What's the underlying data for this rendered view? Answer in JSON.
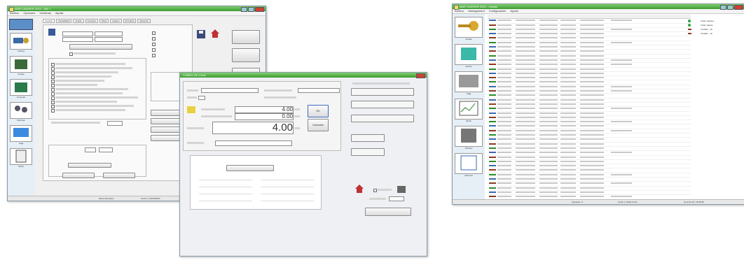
{
  "window1": {
    "title": "MAR CASHIER 2010 - Win 7",
    "menu": [
      "Archivo",
      "Opciones",
      "Ventanas",
      "Ayuda"
    ],
    "toolbar": [
      "Cobros",
      "Ventas",
      "Compras",
      "Informes",
      "Caja",
      "Stock"
    ],
    "tabs": [
      "General",
      "Contabilidad",
      "Ventas",
      "Compras",
      "Stock",
      "Cajeros",
      "Formatos",
      "Opciones"
    ],
    "status": [
      "Modo Operativo",
      "CAJA 1 | 22/10/2010"
    ]
  },
  "window2": {
    "title": "COBRO DE CAJA",
    "amount_1": "4.00",
    "amount_2": "0.00",
    "total": "4.00",
    "ok": "OK",
    "cancel": "Cancelar"
  },
  "window3": {
    "title": "MAR CASHIER 2010 - Listado",
    "menu": [
      "Archivo",
      "Management",
      "Configuración",
      "Ayuda"
    ],
    "toolbar": [
      "Ventas",
      "Cierres",
      "Caja",
      "Stock",
      "Clientes",
      "Informes"
    ],
    "status": [
      "Operador: 3",
      "CAJA 1 | 2010-10-22",
      "Hora 22:10 | 15:48:30"
    ],
    "legend": [
      {
        "label": "Cobro efectivo",
        "color": "#2aa44a"
      },
      {
        "label": "Cobro tarjeta",
        "color": "#2aa44a"
      },
      {
        "label": "TICKET - 15",
        "color": "#8a3a20"
      },
      {
        "label": "TICKET - 16",
        "color": "#8a3a20"
      }
    ]
  }
}
